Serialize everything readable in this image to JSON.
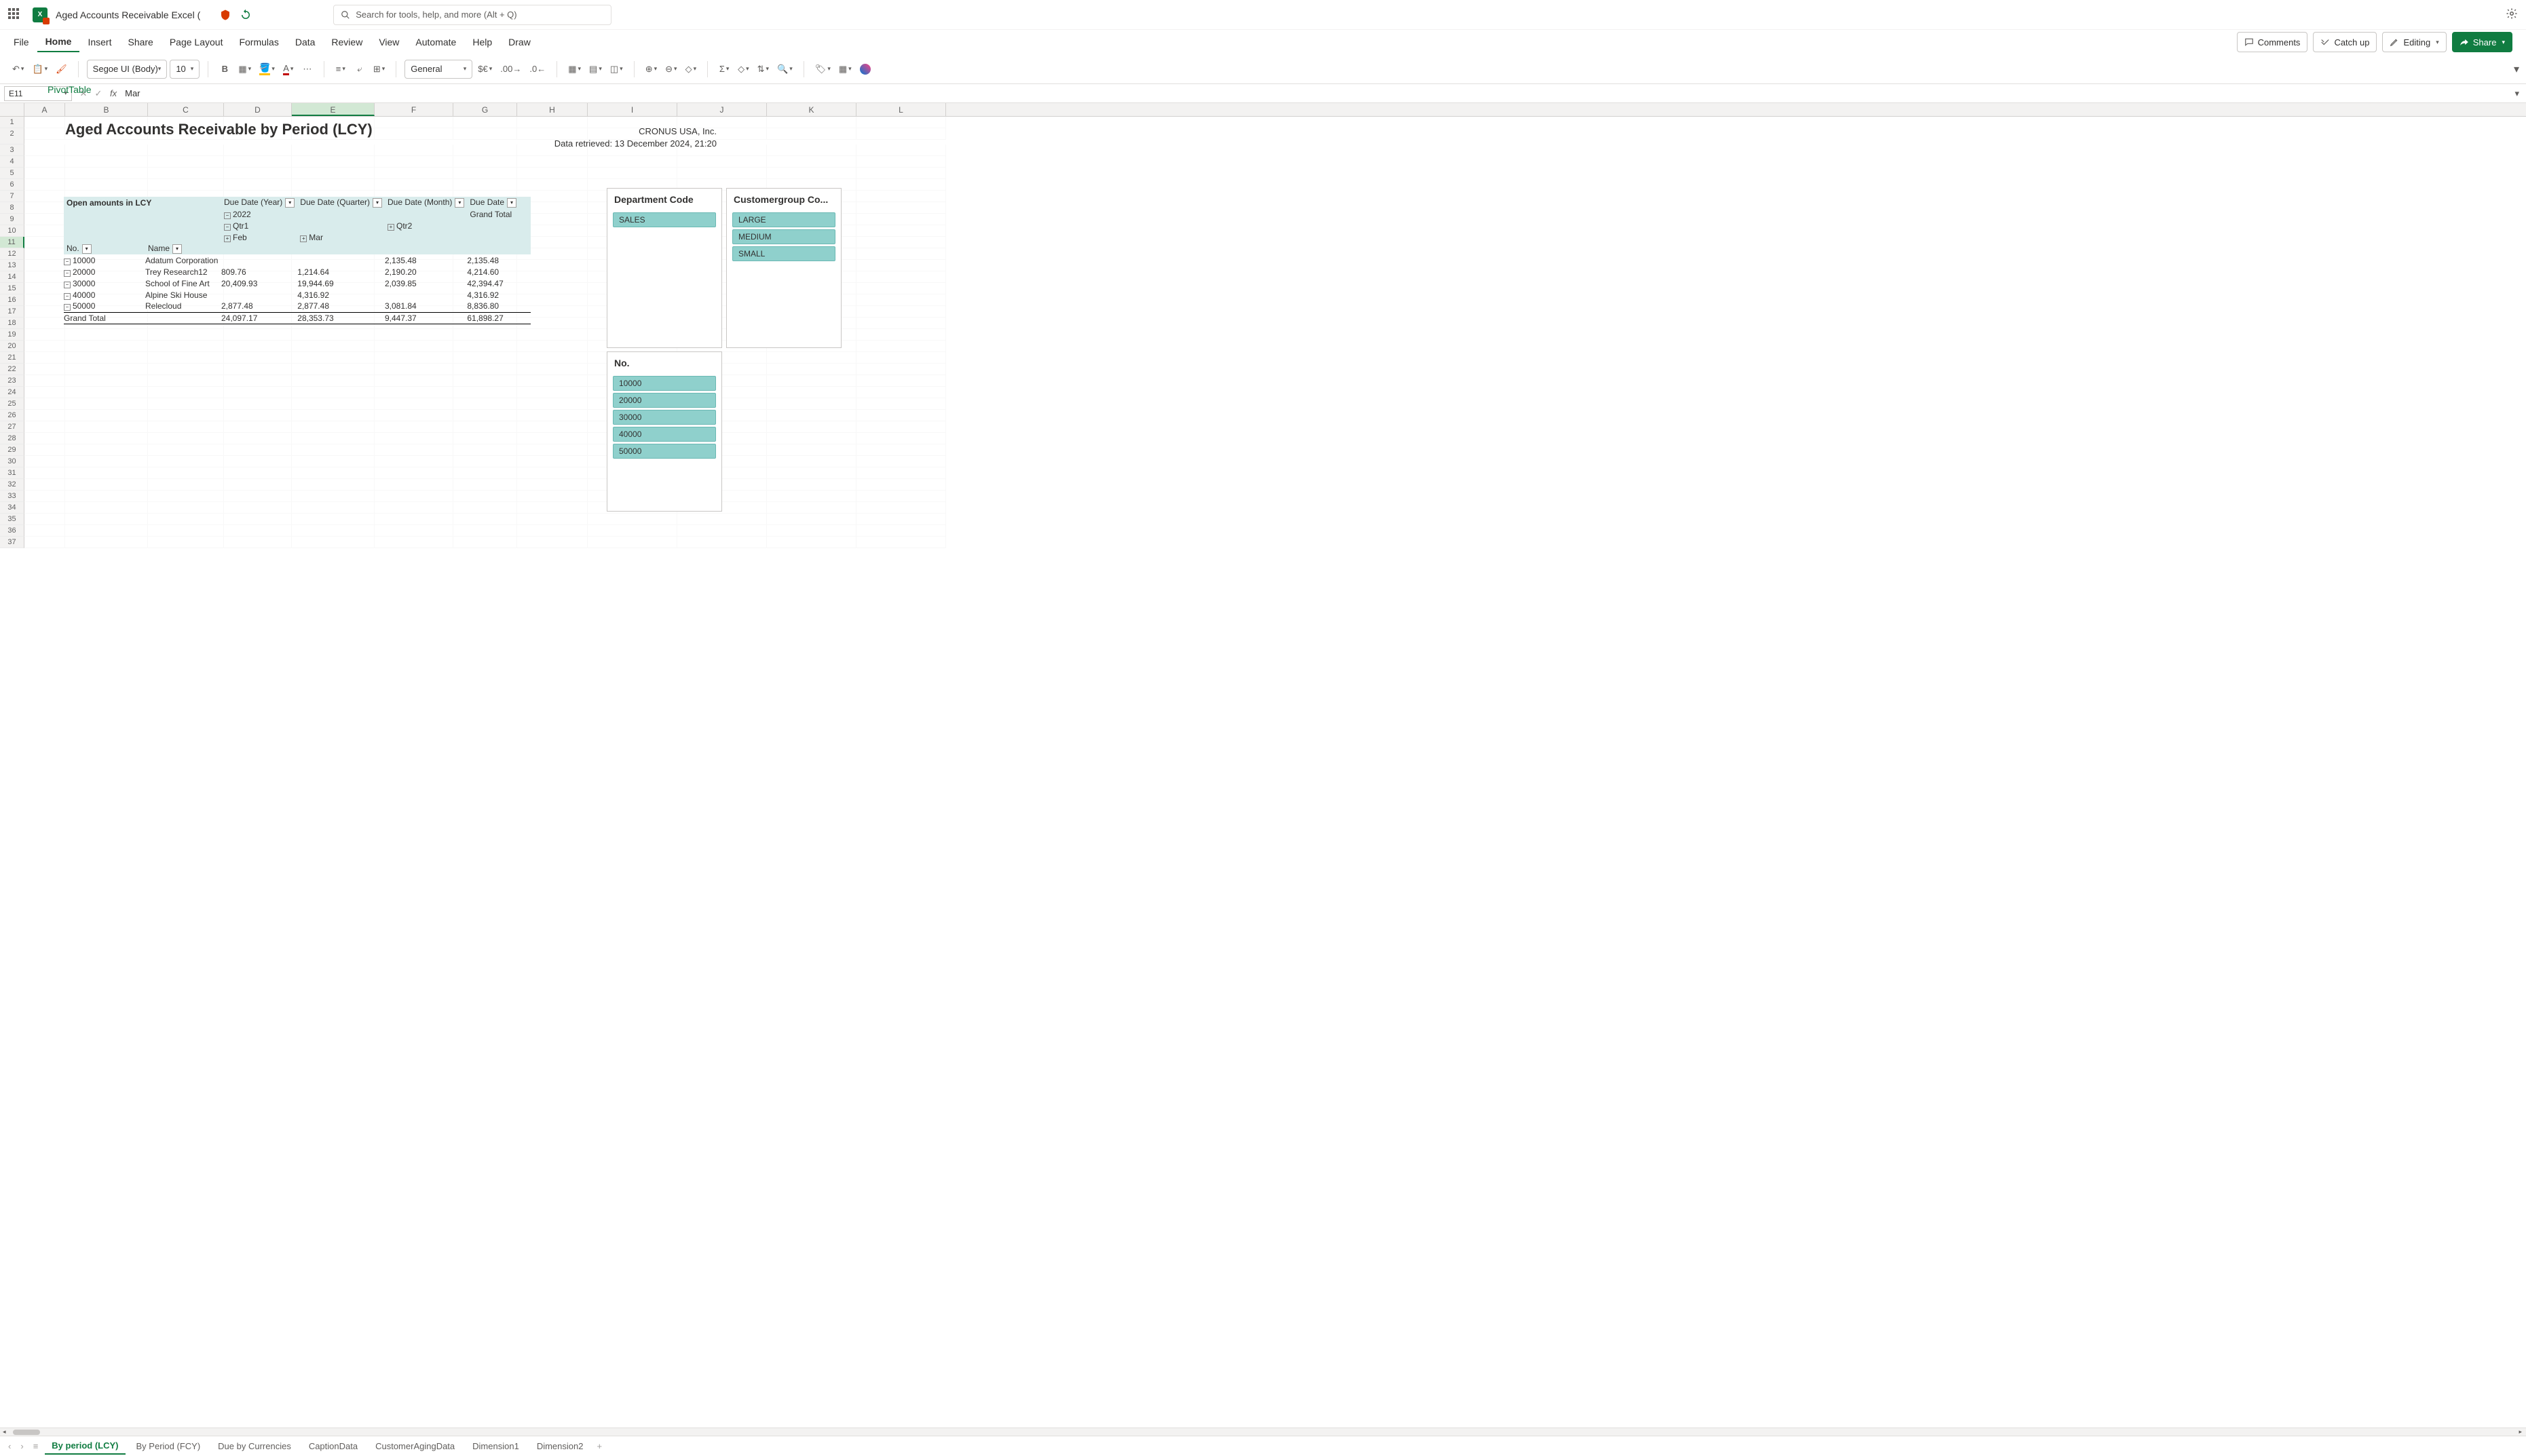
{
  "titlebar": {
    "doc_title": "Aged Accounts Receivable Excel (",
    "search_placeholder": "Search for tools, help, and more (Alt + Q)"
  },
  "ribbon": {
    "tabs": [
      "File",
      "Home",
      "Insert",
      "Share",
      "Page Layout",
      "Formulas",
      "Data",
      "Review",
      "View",
      "Automate",
      "Help",
      "Draw",
      "PivotTable"
    ],
    "active": "Home",
    "comments": "Comments",
    "catchup": "Catch up",
    "editing": "Editing",
    "share": "Share"
  },
  "toolbar": {
    "font": "Segoe UI (Body)",
    "size": "10",
    "numfmt": "General"
  },
  "formulabar": {
    "name": "E11",
    "value": "Mar"
  },
  "columns": [
    "A",
    "B",
    "C",
    "D",
    "E",
    "F",
    "G",
    "H",
    "I",
    "J",
    "K",
    "L"
  ],
  "row_count": 37,
  "active_col": "E",
  "active_row": 11,
  "report": {
    "title": "Aged Accounts Receivable by Period (LCY)",
    "company": "CRONUS USA, Inc.",
    "retrieved": "Data retrieved: 13 December 2024, 21:20"
  },
  "pivot": {
    "measure": "Open amounts in LCY",
    "col_fields": [
      "Due Date (Year)",
      "Due Date (Quarter)",
      "Due Date (Month)",
      "Due Date"
    ],
    "year": "2022",
    "qtr1": "Qtr1",
    "qtr2": "Qtr2",
    "feb": "Feb",
    "mar": "Mar",
    "grand_total_col": "Grand Total",
    "row_fields": [
      "No.",
      "Name"
    ],
    "rows": [
      {
        "no": "10000",
        "name": "Adatum Corporation",
        "d": "",
        "e": "",
        "f": "2,135.48",
        "g": "2,135.48"
      },
      {
        "no": "20000",
        "name": "Trey Research12",
        "d": "809.76",
        "e": "1,214.64",
        "f": "2,190.20",
        "g": "4,214.60"
      },
      {
        "no": "30000",
        "name": "School of Fine Art",
        "d": "20,409.93",
        "e": "19,944.69",
        "f": "2,039.85",
        "g": "42,394.47"
      },
      {
        "no": "40000",
        "name": "Alpine Ski House",
        "d": "",
        "e": "4,316.92",
        "f": "",
        "g": "4,316.92"
      },
      {
        "no": "50000",
        "name": "Relecloud",
        "d": "2,877.48",
        "e": "2,877.48",
        "f": "3,081.84",
        "g": "8,836.80"
      }
    ],
    "grand_total": {
      "label": "Grand Total",
      "d": "24,097.17",
      "e": "28,353.73",
      "f": "9,447.37",
      "g": "61,898.27"
    }
  },
  "slicers": {
    "dept": {
      "title": "Department Code",
      "items": [
        "SALES"
      ]
    },
    "cust": {
      "title": "Customergroup Co...",
      "items": [
        "LARGE",
        "MEDIUM",
        "SMALL"
      ]
    },
    "no": {
      "title": "No.",
      "items": [
        "10000",
        "20000",
        "30000",
        "40000",
        "50000"
      ]
    }
  },
  "sheets": {
    "tabs": [
      "By period (LCY)",
      "By Period (FCY)",
      "Due by Currencies",
      "CaptionData",
      "CustomerAgingData",
      "Dimension1",
      "Dimension2"
    ],
    "active": "By period (LCY)"
  }
}
